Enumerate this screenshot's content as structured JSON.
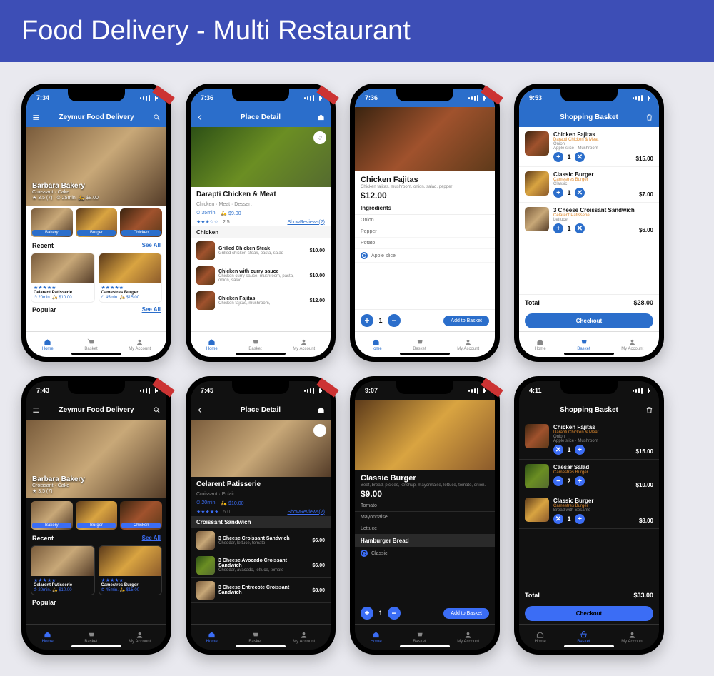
{
  "banner": "Food Delivery - Multi Restaurant",
  "nav": {
    "home": "Home",
    "basket": "Basket",
    "account": "My Account"
  },
  "p1": {
    "time": "7:34",
    "title": "Zeymur Food Delivery",
    "hero": {
      "name": "Barbara Bakery",
      "sub": "Croissant · Cake",
      "rating": "3.5 (7)",
      "time": "25min.",
      "price": "$8.00"
    },
    "cats": [
      "Bakery",
      "Burger",
      "Chicken"
    ],
    "recent": "Recent",
    "seeall": "See All",
    "cards": [
      {
        "name": "Celarent Patisserie",
        "time": "20min.",
        "price": "$10.00"
      },
      {
        "name": "Camestres Burger",
        "time": "45min.",
        "price": "$15.00"
      }
    ],
    "popular": "Popular"
  },
  "p2": {
    "time": "7:36",
    "title": "Place Detail",
    "name": "Darapti Chicken & Meat",
    "sub": "Chicken · Meat · Dessert",
    "tline": "35min.",
    "tprice": "$9.00",
    "rating": "2.5",
    "reviews": "ShowReviews(2)",
    "section": "Chicken",
    "items": [
      {
        "name": "Grilled Chicken Steak",
        "desc": "Grilled chicken steak, pasta, salad",
        "price": "$10.00"
      },
      {
        "name": "Chicken with curry sauce",
        "desc": "Chicken curry sauce, mushroom, pasta, onion, salad",
        "price": "$10.00"
      },
      {
        "name": "Chicken Fajitas",
        "desc": "Chicken fajitas, mushroom,",
        "price": "$12.00"
      }
    ]
  },
  "p3": {
    "time": "7:36",
    "name": "Chicken Fajitas",
    "desc": "Chicken fajitas, mushroom, onion, salad, pepper",
    "price": "$12.00",
    "ing": "Ingredients",
    "ings": [
      "Onion",
      "Pepper",
      "Potato"
    ],
    "opt": "Apple slice",
    "add": "Add to Basket",
    "qty": "1"
  },
  "p4": {
    "time": "9:53",
    "title": "Shopping Basket",
    "items": [
      {
        "name": "Chicken Fajitas",
        "src": "Darapti Chicken & Meat",
        "opt1": "Onion",
        "opt2": "Apple slice · Mushroom",
        "qty": "1",
        "price": "$15.00"
      },
      {
        "name": "Classic Burger",
        "src": "Camestres Burger",
        "opt1": "Classic",
        "qty": "1",
        "price": "$7.00"
      },
      {
        "name": "3 Cheese Croissant Sandwich",
        "src": "Celarent Patisserie",
        "opt1": "Lettuce",
        "qty": "1",
        "price": "$6.00"
      }
    ],
    "totall": "Total",
    "total": "$28.00",
    "checkout": "Checkout"
  },
  "p5": {
    "time": "7:43",
    "title": "Zeymur Food Delivery",
    "hero": {
      "name": "Barbara Bakery",
      "sub": "Croissant · Cake",
      "rating": "3.5 (7)"
    },
    "cats": [
      "Bakery",
      "Burger",
      "Chicken"
    ],
    "recent": "Recent",
    "seeall": "See All",
    "cards": [
      {
        "name": "Celarent Patisserie",
        "time": "20min.",
        "price": "$10.00"
      },
      {
        "name": "Camestres Burger",
        "time": "45min.",
        "price": "$15.00"
      }
    ],
    "popular": "Popular"
  },
  "p6": {
    "time": "7:45",
    "title": "Place Detail",
    "name": "Celarent Patisserie",
    "sub": "Croissant · Eclair",
    "tline": "20min.",
    "tprice": "$10.00",
    "rating": "5.0",
    "reviews": "ShowReviews(2)",
    "section": "Croissant Sandwich",
    "items": [
      {
        "name": "3 Cheese Croissant Sandwich",
        "desc": "Cheddar, lettuce, tomato",
        "price": "$6.00"
      },
      {
        "name": "3 Cheese Avocado Croissant Sandwich",
        "desc": "Cheddar, avacado, lettuce, tomato",
        "price": "$6.00"
      },
      {
        "name": "3 Cheese Entrecote Croissant Sandwich",
        "desc": "",
        "price": "$8.00"
      }
    ]
  },
  "p7": {
    "time": "9:07",
    "name": "Classic Burger",
    "desc": "Beef, bread, pickles, ketchup, mayonnaise, lettuce, tomato, onion.",
    "price": "$9.00",
    "ings": [
      "Tomato",
      "Mayonnaise",
      "Lettuce"
    ],
    "section": "Hamburger Bread",
    "opt": "Classic",
    "add": "Add to Basket",
    "qty": "1"
  },
  "p8": {
    "time": "4:11",
    "title": "Shopping Basket",
    "items": [
      {
        "name": "Chicken Fajitas",
        "src": "Darapti Chicken & Meat",
        "opt1": "Onion",
        "opt2": "Apple slice · Mushroom",
        "qty": "1",
        "price": "$15.00"
      },
      {
        "name": "Caesar Salad",
        "src": "Camestres Burger",
        "qty": "2",
        "price": "$10.00"
      },
      {
        "name": "Classic Burger",
        "src": "Camestres Burger",
        "opt1": "Bread with Sesame",
        "qty": "1",
        "price": "$8.00"
      }
    ],
    "totall": "Total",
    "total": "$33.00",
    "checkout": "Checkout"
  }
}
